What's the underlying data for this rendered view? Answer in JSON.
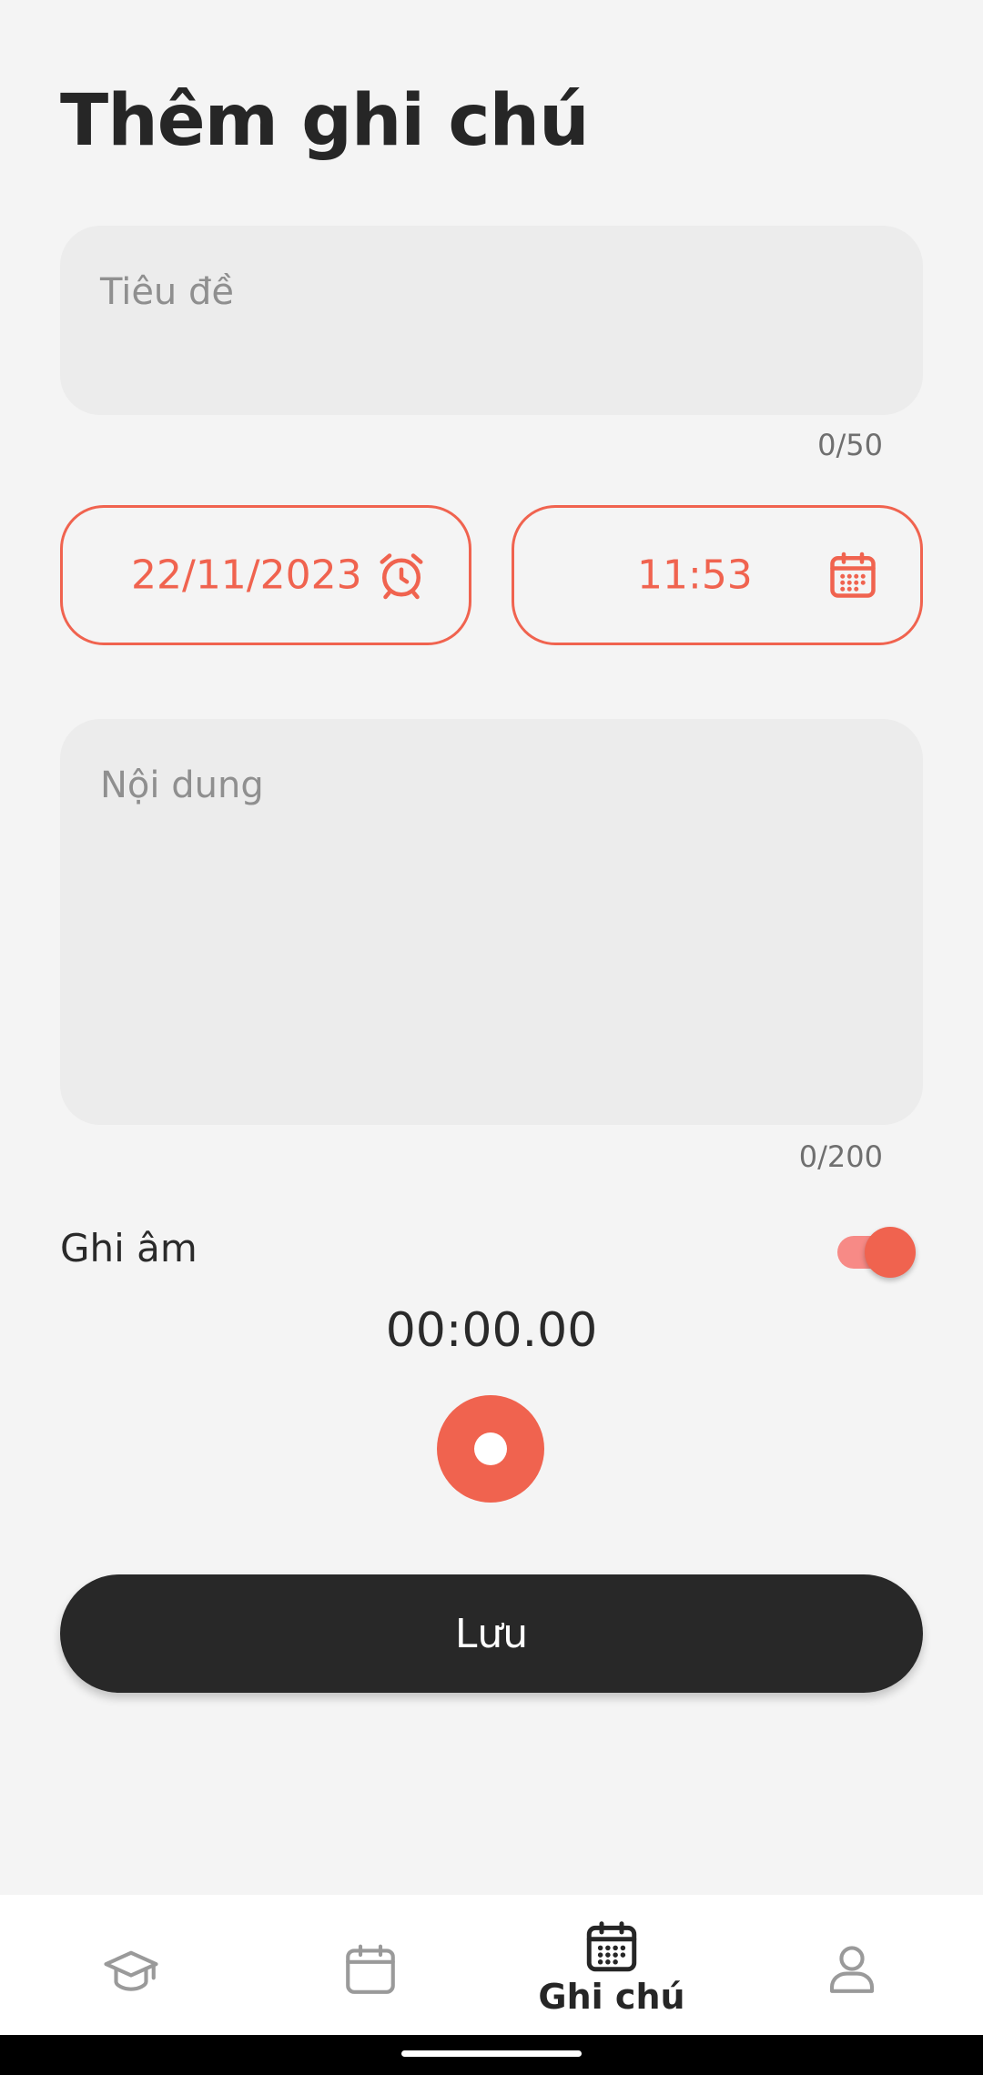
{
  "header": {
    "title": "Thêm ghi chú"
  },
  "title_field": {
    "placeholder": "Tiêu đề",
    "counter": "0/50"
  },
  "date_button": {
    "value": "22/11/2023",
    "icon": "alarm-clock-icon"
  },
  "time_button": {
    "value": "11:53",
    "icon": "calendar-icon"
  },
  "content_field": {
    "placeholder": "Nội dung",
    "counter": "0/200"
  },
  "recording": {
    "label": "Ghi âm",
    "enabled": true,
    "timer": "00:00.00"
  },
  "save_button": {
    "label": "Lưu"
  },
  "bottom_nav": {
    "items": [
      {
        "icon": "graduation-cap-icon",
        "label": ""
      },
      {
        "icon": "calendar-icon",
        "label": ""
      },
      {
        "icon": "calendar-grid-icon",
        "label": "Ghi chú",
        "active": true
      },
      {
        "icon": "user-icon",
        "label": ""
      }
    ]
  },
  "colors": {
    "accent": "#f0634f",
    "background": "#f4f4f4",
    "field": "#ececec",
    "dark": "#282828"
  }
}
